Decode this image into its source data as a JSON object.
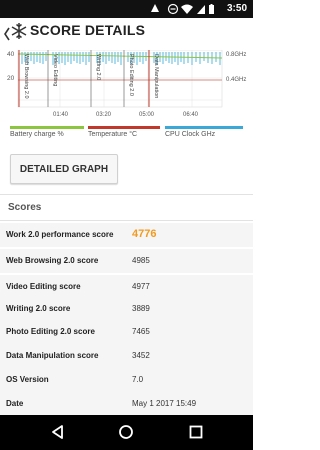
{
  "status_bar": {
    "time": "3:50"
  },
  "app_bar": {
    "title": "SCORE DETAILS"
  },
  "chart": {
    "y_ticks": [
      "40",
      "20"
    ],
    "y2_ticks": [
      "0.8GHz",
      "0.4GHz"
    ],
    "x_ticks": [
      "01:40",
      "03:20",
      "05:00",
      "06:40"
    ],
    "markers": [
      "Web Browsing 2.0",
      "Video Editing",
      "Writing 2.0",
      "Photo Editing 2.0",
      "Data Manipulation"
    ]
  },
  "legend": {
    "items": [
      {
        "label": "Battery charge %",
        "color": "#8cc63f"
      },
      {
        "label": "Temperature °C",
        "color": "#c0392b"
      },
      {
        "label": "CPU Clock GHz",
        "color": "#3aa9d8"
      }
    ]
  },
  "detailed_graph_button": "DETAILED GRAPH",
  "scores_title": "Scores",
  "scores": [
    {
      "label": "Work 2.0 performance score",
      "value": "4776"
    },
    {
      "label": "Web Browsing 2.0 score",
      "value": "4985"
    },
    {
      "label": "Video Editing score",
      "value": "4977"
    },
    {
      "label": "Writing 2.0 score",
      "value": "3889"
    },
    {
      "label": "Photo Editing 2.0 score",
      "value": "7465"
    },
    {
      "label": "Data Manipulation score",
      "value": "3452"
    },
    {
      "label": "OS Version",
      "value": "7.0"
    },
    {
      "label": "Date",
      "value": "May 1 2017 15:49"
    }
  ]
}
